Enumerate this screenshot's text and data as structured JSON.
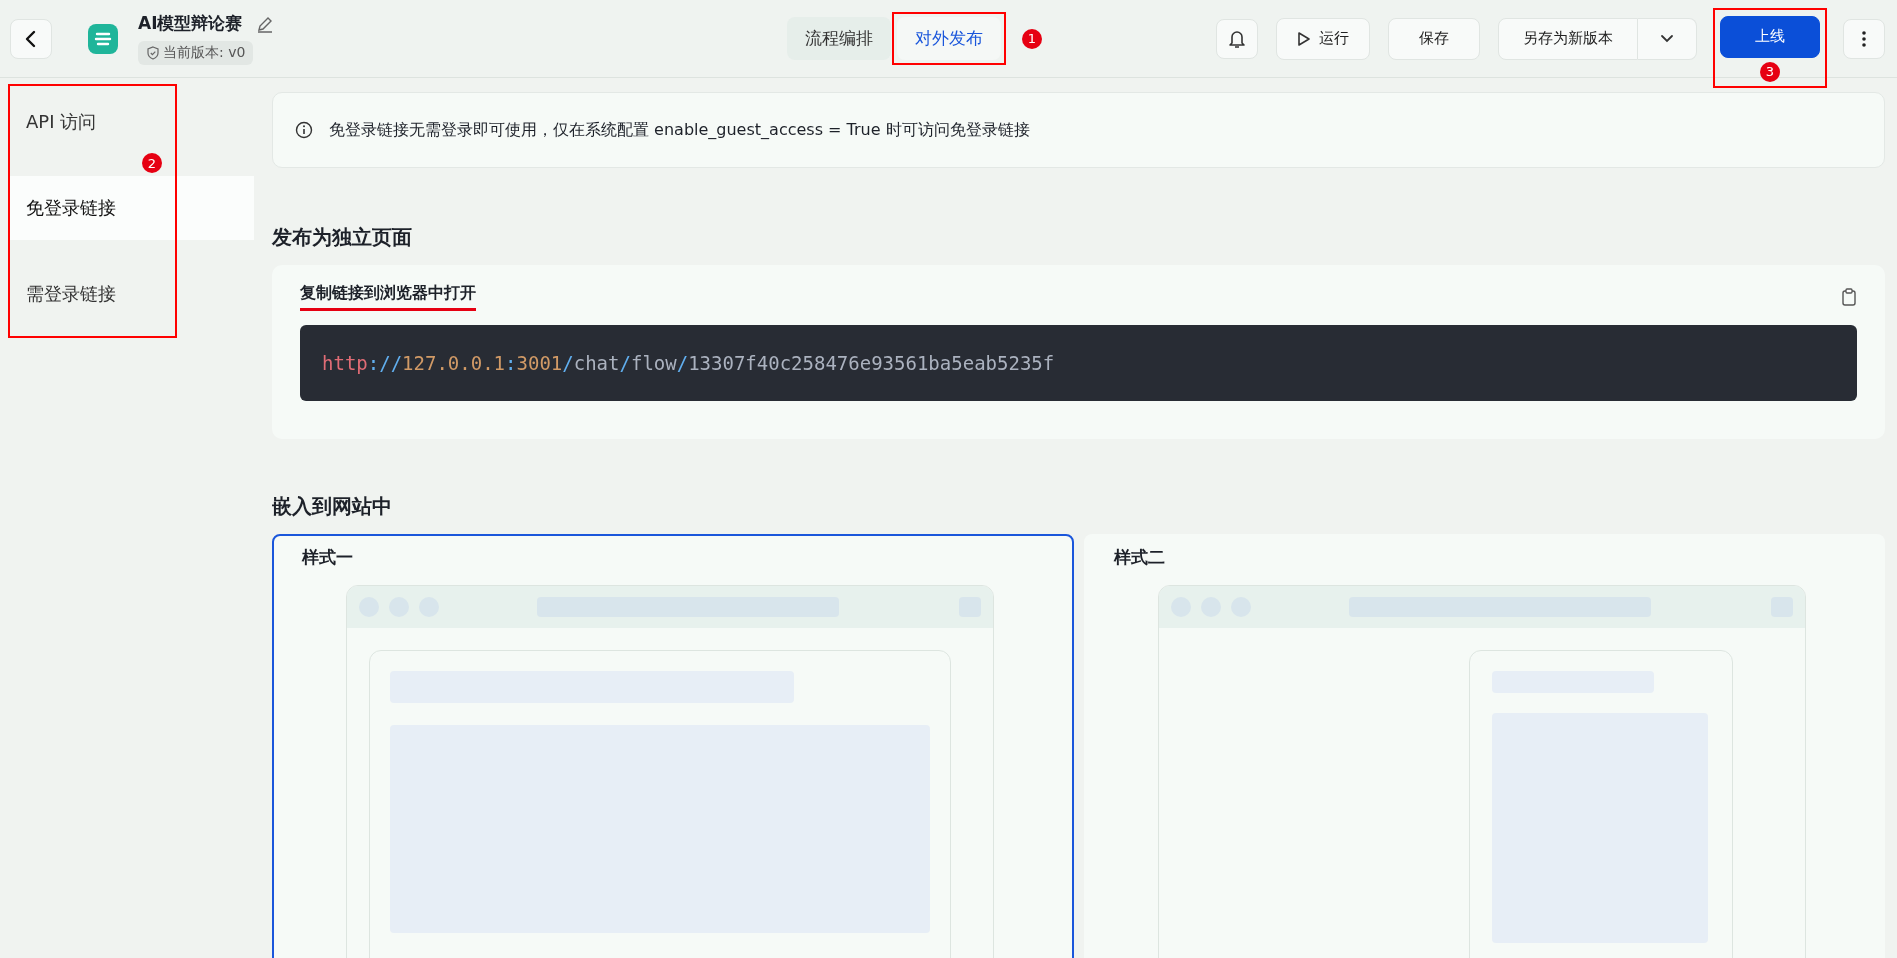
{
  "header": {
    "title": "AI模型辩论赛",
    "version": "当前版本: v0",
    "tabs": [
      {
        "label": "流程编排",
        "selected": false
      },
      {
        "label": "对外发布",
        "selected": true,
        "callout": "1"
      }
    ],
    "buttons": [
      {
        "label": "运行",
        "kind": "run"
      },
      {
        "label": "保存",
        "kind": "plain"
      },
      {
        "label": "另存为新版本",
        "kind": "split"
      },
      {
        "label": "上线",
        "kind": "primary",
        "callout": "3"
      }
    ]
  },
  "sidebar": {
    "callout": "2",
    "items": [
      {
        "label": "API 访问",
        "selected": false
      },
      {
        "label": "免登录链接",
        "selected": true
      },
      {
        "label": "需登录链接",
        "selected": false
      }
    ]
  },
  "notice": "免登录链接无需登录即可使用，仅在系统配置 enable_guest_access = True 时可访问免登录链接",
  "standalone": {
    "heading": "发布为独立页面",
    "card_title": "复制链接到浏览器中打开",
    "underlined": true,
    "url_parts": [
      {
        "text": "http",
        "kind": "scheme"
      },
      {
        "text": "://",
        "kind": "punct"
      },
      {
        "text": "127.0.0.1",
        "kind": "number"
      },
      {
        "text": ":",
        "kind": "punct"
      },
      {
        "text": "3001",
        "kind": "number"
      },
      {
        "text": "/",
        "kind": "punct"
      },
      {
        "text": "chat",
        "kind": "plain"
      },
      {
        "text": "/",
        "kind": "punct"
      },
      {
        "text": "flow",
        "kind": "plain"
      },
      {
        "text": "/",
        "kind": "punct"
      },
      {
        "text": "13307f40c258476e93561ba5eab5235f",
        "kind": "plain"
      }
    ]
  },
  "embed": {
    "heading": "嵌入到网站中",
    "styles": [
      {
        "label": "样式一",
        "selected": true,
        "kind": "full"
      },
      {
        "label": "样式二",
        "selected": false,
        "kind": "widget"
      }
    ]
  }
}
